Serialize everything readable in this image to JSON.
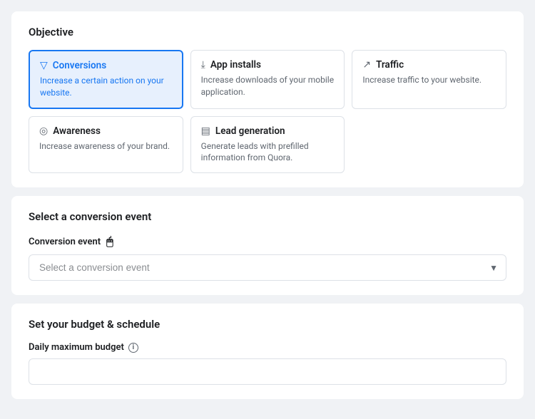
{
  "objective_section": {
    "title": "Objective",
    "cards": [
      {
        "id": "conversions",
        "icon": "▼",
        "title": "Conversions",
        "description": "Increase a certain action on your website.",
        "selected": true
      },
      {
        "id": "app_installs",
        "icon": "⬇",
        "title": "App installs",
        "description": "Increase downloads of your mobile application.",
        "selected": false
      },
      {
        "id": "traffic",
        "icon": "↗",
        "title": "Traffic",
        "description": "Increase traffic to your website.",
        "selected": false
      },
      {
        "id": "awareness",
        "icon": "👁",
        "title": "Awareness",
        "description": "Increase awareness of your brand.",
        "selected": false
      },
      {
        "id": "lead_generation",
        "icon": "🗒",
        "title": "Lead generation",
        "description": "Generate leads with prefilled information from Quora.",
        "selected": false
      }
    ]
  },
  "conversion_section": {
    "title": "Select a conversion event",
    "field_label": "Conversion event",
    "select_placeholder": "Select a conversion event"
  },
  "budget_section": {
    "title": "Set your budget & schedule",
    "field_label": "Daily maximum budget",
    "field_placeholder": ""
  }
}
